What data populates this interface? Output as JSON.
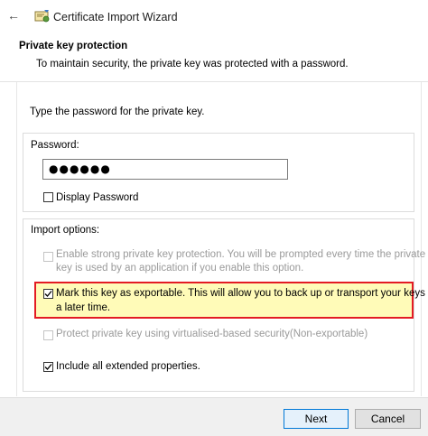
{
  "window": {
    "title": "Certificate Import Wizard",
    "back_icon": "back-arrow-icon",
    "app_icon": "certificate-icon"
  },
  "header": {
    "section_title": "Private key protection",
    "section_description": "To maintain security, the private key was protected with a password."
  },
  "password_prompt": "Type the password for the private key.",
  "password_group": {
    "label": "Password:",
    "value": "●●●●●●",
    "display_password": {
      "label": "Display Password",
      "checked": false
    }
  },
  "import_options": {
    "label": "Import options:",
    "options": [
      {
        "line1": "Enable strong private key protection. You will be prompted every time the private",
        "line2": "key is used by an application if you enable this option.",
        "checked": false,
        "enabled": false
      },
      {
        "line1": "Mark this key as exportable. This will allow you to back up or transport your keys at",
        "line2": "a later time.",
        "checked": true,
        "enabled": true,
        "highlighted": true
      },
      {
        "line1": "Protect private key using virtualised-based security(Non-exportable)",
        "checked": false,
        "enabled": false
      },
      {
        "line1": "Include all extended properties.",
        "checked": true,
        "enabled": true
      }
    ]
  },
  "footer": {
    "next_label": "Next",
    "cancel_label": "Cancel"
  },
  "colors": {
    "highlight_border": "#e31b23",
    "highlight_fill": "#fffbb8",
    "default_button_border": "#0078d7"
  }
}
